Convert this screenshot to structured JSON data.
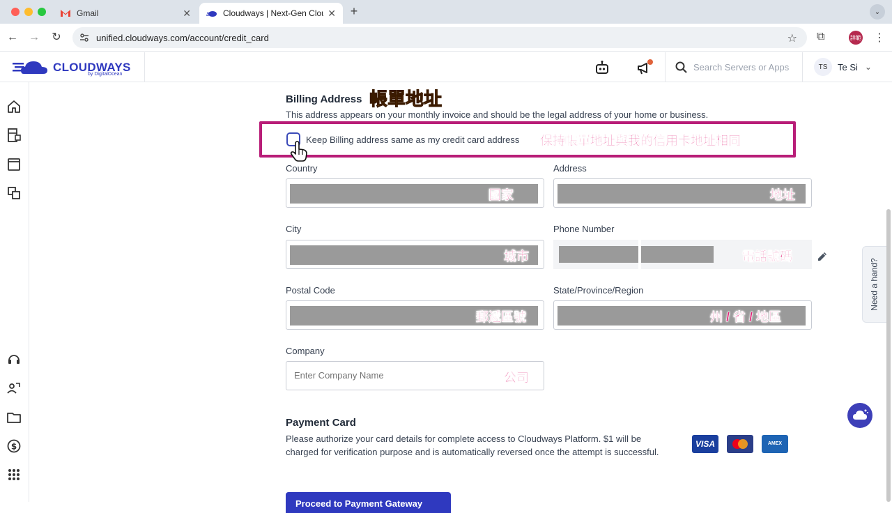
{
  "browser": {
    "tabs": [
      {
        "title": "Gmail",
        "active": false
      },
      {
        "title": "Cloudways | Next-Gen Cloud",
        "active": true
      }
    ],
    "url": "unified.cloudways.com/account/credit_card",
    "profile_initials": "詳範"
  },
  "header": {
    "brand": "CLOUDWAYS",
    "brand_sub": "by DigitalOcean",
    "search_placeholder": "Search Servers or Apps",
    "user_initials": "TS",
    "user_name": "Te Si"
  },
  "billing": {
    "title": "Billing Address",
    "title_cn": "帳單地址",
    "description": "This address appears on your monthly invoice and should be the legal address of your home or business.",
    "same_address_label": "Keep Billing address same as my credit card address",
    "same_address_cn": "保持帳單地址與我的信用卡地址相同",
    "same_address_checked": false,
    "fields": {
      "country": {
        "label": "Country",
        "cn": "國家"
      },
      "address": {
        "label": "Address",
        "cn": "地址"
      },
      "city": {
        "label": "City",
        "cn": "城市"
      },
      "phone": {
        "label": "Phone Number",
        "cn": "電話號碼"
      },
      "postal": {
        "label": "Postal Code",
        "cn": "郵遞區號"
      },
      "state": {
        "label": "State/Province/Region",
        "cn": "州 / 省 / 地區"
      },
      "company": {
        "label": "Company",
        "cn": "公司",
        "placeholder": "Enter Company Name"
      }
    }
  },
  "payment": {
    "title": "Payment Card",
    "description": "Please authorize your card details for complete access to Cloudways Platform. $1 will be charged for verification purpose and is automatically reversed once the attempt is successful.",
    "cards": [
      "VISA",
      "MC",
      "AMEX"
    ],
    "button_label": "Proceed to Payment Gateway"
  },
  "help": {
    "label": "Need a hand?"
  },
  "colors": {
    "brand": "#2f39bf",
    "highlight": "#b81d78",
    "annotation": "#e11d74"
  }
}
